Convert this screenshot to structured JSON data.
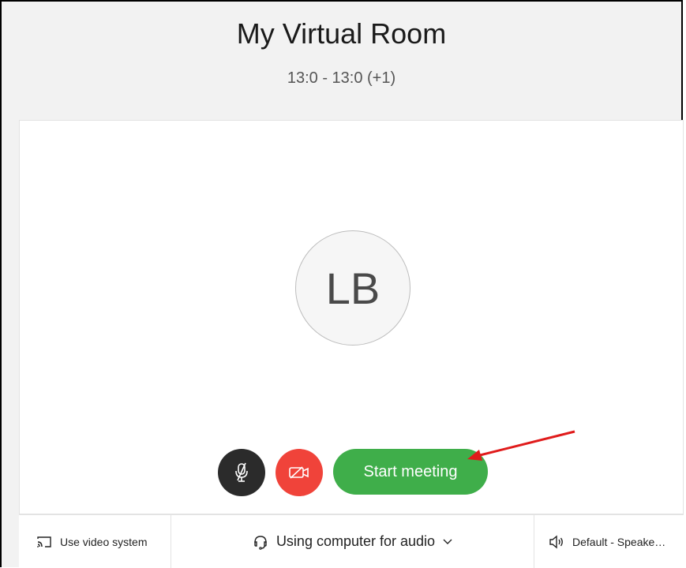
{
  "room": {
    "title": "My Virtual Room",
    "time_range": "13:0 - 13:0 (+1)"
  },
  "avatar": {
    "initials": "LB"
  },
  "controls": {
    "start_label": "Start meeting",
    "mute_icon": "microphone-muted-icon",
    "video_icon": "video-off-icon"
  },
  "footer": {
    "video_system_label": "Use video system",
    "audio_label": "Using computer for audio",
    "speaker_label": "Default - Speake…"
  },
  "colors": {
    "start_button": "#3fae4a",
    "video_button": "#f0433a",
    "mute_button": "#2b2b2b",
    "annotation_arrow": "#e01b1b"
  }
}
